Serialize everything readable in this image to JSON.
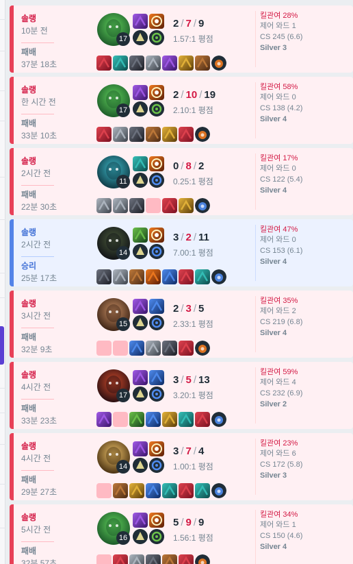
{
  "labels": {
    "kp_prefix": "킬관여 ",
    "ward_prefix": "제어 와드 ",
    "cs_prefix": "CS ",
    "ratio_suffix": " 평점",
    "slash": "/"
  },
  "colors": {
    "loss_bg": "#fff0f3",
    "win_bg": "#ecf2ff",
    "loss_accent": "#e84057",
    "win_accent": "#5383e8"
  },
  "matches": [
    {
      "queue": "솔랭",
      "ago": "10분 전",
      "result_label": "패배",
      "duration": "37분 18초",
      "win": false,
      "champion_icon": "green-monster-champion-icon",
      "level": "17",
      "spells": [
        "purple-spell-icon",
        "orange-flash-spell-icon"
      ],
      "runes": [
        "yellow-keystone-rune-icon",
        "green-resolve-rune-icon"
      ],
      "kills": "2",
      "deaths": "7",
      "assists": "9",
      "ratio": "1.57:1",
      "items": [
        "red-item-icon",
        "teal-item-icon",
        "dark-item-icon",
        "grey-item-icon",
        "purple-item-icon",
        "gold-item-icon",
        "brown-item-icon",
        "orange-trinket-icon"
      ],
      "kill_participation": "28%",
      "control_wards": "1",
      "cs": "245 (6.6)",
      "tier": "Silver 3"
    },
    {
      "queue": "솔랭",
      "ago": "한 시간 전",
      "result_label": "패배",
      "duration": "33분 10초",
      "win": false,
      "champion_icon": "green-monster-champion-icon",
      "level": "17",
      "spells": [
        "purple-spell-icon",
        "orange-flash-spell-icon"
      ],
      "runes": [
        "yellow-keystone-rune-icon",
        "green-resolve-rune-icon"
      ],
      "kills": "2",
      "deaths": "10",
      "assists": "19",
      "ratio": "2.10:1",
      "items": [
        "red-item-icon",
        "grey-item-icon",
        "dark-item-icon",
        "brown-item-icon",
        "gold-item-icon",
        "red-item-icon",
        "orange-trinket-icon"
      ],
      "kill_participation": "58%",
      "control_wards": "0",
      "cs": "138 (4.2)",
      "tier": "Silver 4"
    },
    {
      "queue": "솔랭",
      "ago": "2시간 전",
      "result_label": "패배",
      "duration": "22분 30초",
      "win": false,
      "champion_icon": "teal-assassin-champion-icon",
      "level": "11",
      "spells": [
        "teal-spell-icon",
        "orange-flash-spell-icon"
      ],
      "runes": [
        "yellow-keystone-rune-icon",
        "blue-inspiration-rune-icon"
      ],
      "kills": "0",
      "deaths": "8",
      "assists": "2",
      "ratio": "0.25:1",
      "items": [
        "grey-item-icon",
        "grey-item-icon",
        "dark-item-icon",
        "empty",
        "red-item-icon",
        "gold-item-icon",
        "blue-trinket-icon"
      ],
      "kill_participation": "17%",
      "control_wards": "0",
      "cs": "122 (5.4)",
      "tier": "Silver 4"
    },
    {
      "queue": "솔랭",
      "ago": "2시간 전",
      "result_label": "승리",
      "duration": "25분 17초",
      "win": true,
      "champion_icon": "dark-mage-champion-icon",
      "level": "14",
      "spells": [
        "green-spell-icon",
        "orange-flash-spell-icon"
      ],
      "runes": [
        "yellow-keystone-rune-icon",
        "blue-inspiration-rune-icon"
      ],
      "kills": "3",
      "deaths": "2",
      "assists": "11",
      "ratio": "7.00:1",
      "items": [
        "dark-item-icon",
        "grey-item-icon",
        "brown-item-icon",
        "orange-item-icon",
        "blue-item-icon",
        "red-item-icon",
        "teal-item-icon",
        "blue-trinket-icon"
      ],
      "kill_participation": "47%",
      "control_wards": "0",
      "cs": "153 (6.1)",
      "tier": "Silver 4"
    },
    {
      "queue": "솔랭",
      "ago": "3시간 전",
      "result_label": "패배",
      "duration": "32분 9초",
      "win": false,
      "champion_icon": "brown-hair-champion-icon",
      "level": "15",
      "spells": [
        "purple-spell-icon",
        "blue-spell-icon"
      ],
      "runes": [
        "yellow-keystone-rune-icon",
        "blue-inspiration-rune-icon"
      ],
      "kills": "2",
      "deaths": "3",
      "assists": "5",
      "ratio": "2.33:1",
      "items": [
        "empty",
        "empty",
        "blue-item-icon",
        "grey-item-icon",
        "dark-item-icon",
        "red-item-icon",
        "orange-trinket-icon"
      ],
      "kill_participation": "35%",
      "control_wards": "2",
      "cs": "219 (6.8)",
      "tier": "Silver 4"
    },
    {
      "queue": "솔랭",
      "ago": "4시간 전",
      "result_label": "패배",
      "duration": "33분 23초",
      "win": false,
      "champion_icon": "red-armor-champion-icon",
      "level": "17",
      "spells": [
        "purple-spell-icon",
        "blue-spell-icon"
      ],
      "runes": [
        "yellow-keystone-rune-icon",
        "blue-inspiration-rune-icon"
      ],
      "kills": "3",
      "deaths": "5",
      "assists": "13",
      "ratio": "3.20:1",
      "items": [
        "purple-item-icon",
        "empty",
        "green-item-icon",
        "blue-item-icon",
        "gold-item-icon",
        "teal-item-icon",
        "red-item-icon",
        "blue-trinket-icon"
      ],
      "kill_participation": "59%",
      "control_wards": "4",
      "cs": "232 (6.9)",
      "tier": "Silver 2"
    },
    {
      "queue": "솔랭",
      "ago": "4시간 전",
      "result_label": "패배",
      "duration": "29분 27초",
      "win": false,
      "champion_icon": "blonde-champion-icon",
      "level": "14",
      "spells": [
        "purple-spell-icon",
        "orange-flash-spell-icon"
      ],
      "runes": [
        "yellow-keystone-rune-icon",
        "blue-inspiration-rune-icon"
      ],
      "kills": "3",
      "deaths": "7",
      "assists": "4",
      "ratio": "1.00:1",
      "items": [
        "empty",
        "brown-item-icon",
        "gold-item-icon",
        "blue-item-icon",
        "teal-item-icon",
        "red-item-icon",
        "teal-item-icon",
        "blue-trinket-icon"
      ],
      "kill_participation": "23%",
      "control_wards": "6",
      "cs": "172 (5.8)",
      "tier": "Silver 3"
    },
    {
      "queue": "솔랭",
      "ago": "5시간 전",
      "result_label": "패배",
      "duration": "32분 57초",
      "win": false,
      "champion_icon": "green-monster-champion-icon",
      "level": "16",
      "spells": [
        "purple-spell-icon",
        "orange-flash-spell-icon"
      ],
      "runes": [
        "yellow-keystone-rune-icon",
        "green-resolve-rune-icon"
      ],
      "kills": "5",
      "deaths": "9",
      "assists": "9",
      "ratio": "1.56:1",
      "items": [
        "empty",
        "red-item-icon",
        "grey-item-icon",
        "dark-item-icon",
        "brown-item-icon",
        "red-item-icon",
        "orange-trinket-icon"
      ],
      "kill_participation": "34%",
      "control_wards": "1",
      "cs": "150 (4.6)",
      "tier": "Silver 4"
    }
  ]
}
